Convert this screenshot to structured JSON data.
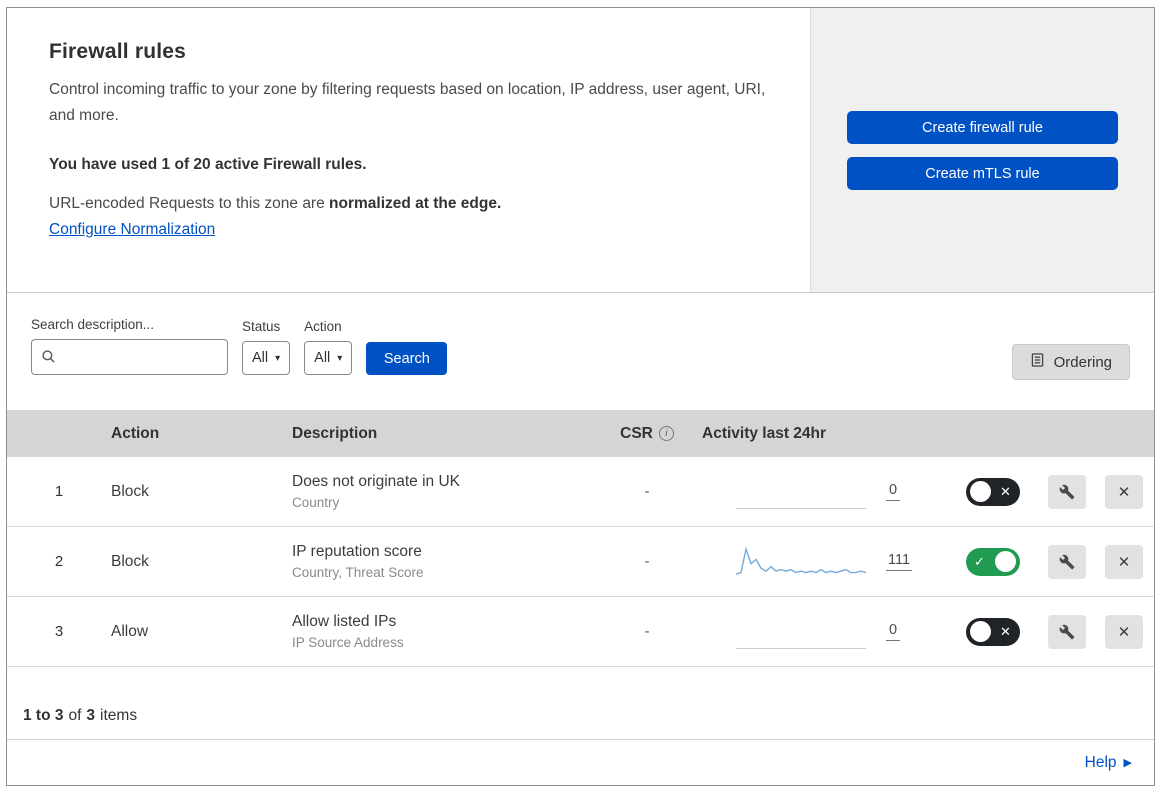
{
  "header": {
    "title": "Firewall rules",
    "description": "Control incoming traffic to your zone by filtering requests based on location, IP address, user agent, URI, and more.",
    "usage": "You have used 1 of 20 active Firewall rules.",
    "normalization_prefix": "URL-encoded Requests to this zone are ",
    "normalization_bold": "normalized at the edge.",
    "normalization_link": "Configure Normalization",
    "create_firewall_label": "Create firewall rule",
    "create_mtls_label": "Create mTLS rule"
  },
  "filters": {
    "search_label": "Search description...",
    "status_label": "Status",
    "status_value": "All",
    "action_label": "Action",
    "action_value": "All",
    "search_button_label": "Search",
    "ordering_button_label": "Ordering"
  },
  "table": {
    "headers": {
      "action": "Action",
      "description": "Description",
      "csr": "CSR",
      "activity": "Activity last 24hr"
    },
    "rows": [
      {
        "priority": "1",
        "action": "Block",
        "description": "Does not originate in UK",
        "criteria": "Country",
        "csr": "-",
        "activity_count": "0",
        "enabled": false,
        "sparkline": []
      },
      {
        "priority": "2",
        "action": "Block",
        "description": "IP reputation score",
        "criteria": "Country, Threat Score",
        "csr": "-",
        "activity_count": "111",
        "enabled": true,
        "sparkline": [
          2,
          3,
          19,
          9,
          12,
          6,
          4,
          7,
          4,
          5,
          4,
          5,
          3,
          4,
          3,
          4,
          3,
          5,
          3,
          4,
          3,
          4,
          5,
          3,
          3,
          4,
          3
        ]
      },
      {
        "priority": "3",
        "action": "Allow",
        "description": "Allow listed IPs",
        "criteria": "IP Source Address",
        "csr": "-",
        "activity_count": "0",
        "enabled": false,
        "sparkline": []
      }
    ]
  },
  "footer": {
    "range": "1 to 3",
    "of": "of",
    "total": "3",
    "items": "items",
    "help_label": "Help"
  },
  "colors": {
    "accent": "#0051c3",
    "toggle_on": "#219a52",
    "toggle_off": "#202428",
    "sparkline": "#74aadd"
  }
}
